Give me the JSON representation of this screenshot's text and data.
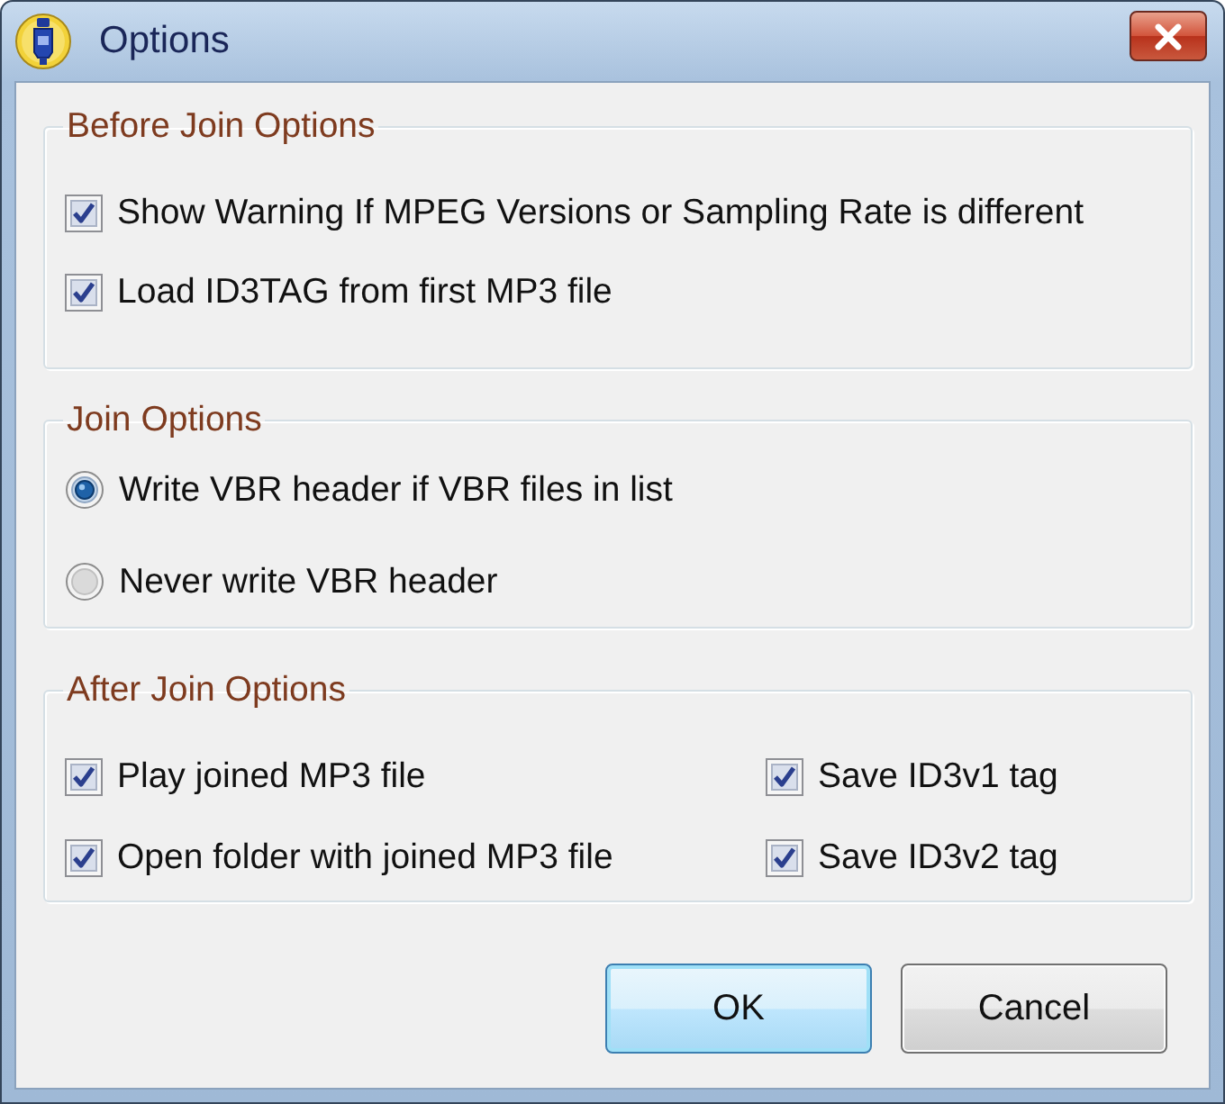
{
  "window": {
    "title": "Options"
  },
  "groups": [
    {
      "title": "Before Join Options",
      "kind": "checkboxes",
      "items": [
        {
          "label": "Show Warning If MPEG Versions or Sampling Rate is different",
          "checked": true
        },
        {
          "label": "Load ID3TAG from first MP3 file",
          "checked": true
        }
      ]
    },
    {
      "title": "Join Options",
      "kind": "radios",
      "items": [
        {
          "label": "Write VBR header if VBR files in list",
          "selected": true
        },
        {
          "label": "Never write VBR header",
          "selected": false
        }
      ]
    },
    {
      "title": "After Join Options",
      "kind": "checkbox-grid",
      "items": [
        {
          "label": "Play joined MP3 file",
          "checked": true
        },
        {
          "label": "Save ID3v1 tag",
          "checked": true
        },
        {
          "label": "Open folder with joined MP3 file",
          "checked": true
        },
        {
          "label": "Save ID3v2 tag",
          "checked": true
        }
      ]
    }
  ],
  "buttons": [
    {
      "label": "OK",
      "focused": true
    },
    {
      "label": "Cancel",
      "focused": false
    }
  ]
}
